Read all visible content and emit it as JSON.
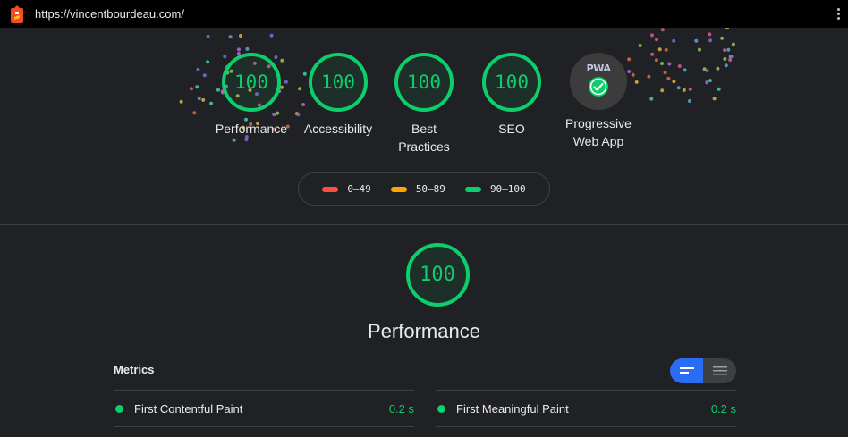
{
  "browser": {
    "url": "https://vincentbourdeau.com/",
    "logo_icon": "lighthouse-icon",
    "menu_icon": "kebab-menu-icon"
  },
  "colors": {
    "pass": "#0cce6b",
    "average": "#ffa400",
    "fail": "#ff4e42",
    "accent": "#2a6df4",
    "background": "#202124"
  },
  "gauges": [
    {
      "score": "100",
      "label": "Performance"
    },
    {
      "score": "100",
      "label": "Accessibility"
    },
    {
      "score": "100",
      "label": "Best Practices"
    },
    {
      "score": "100",
      "label": "SEO"
    }
  ],
  "pwa": {
    "badge_text": "PWA",
    "label": "Progressive Web App",
    "icon": "pwa-check-icon"
  },
  "legend": [
    {
      "range": "0–49",
      "color": "#ff4e42"
    },
    {
      "range": "50–89",
      "color": "#ffa400"
    },
    {
      "range": "90–100",
      "color": "#0cce6b"
    }
  ],
  "performance": {
    "score": "100",
    "title": "Performance"
  },
  "metrics": {
    "title": "Metrics",
    "view_toggle": [
      "compact-view-icon",
      "expanded-view-icon"
    ],
    "items": [
      {
        "name": "First Contentful Paint",
        "value": "0.2 s"
      },
      {
        "name": "First Meaningful Paint",
        "value": "0.2 s"
      }
    ]
  }
}
